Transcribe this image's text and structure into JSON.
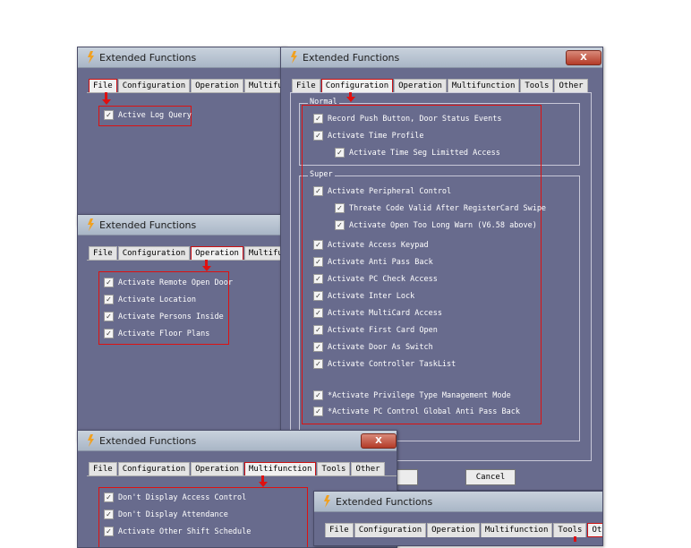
{
  "window_title": "Extended Functions",
  "close_glyph": "X",
  "tabs": {
    "file": "File",
    "configuration": "Configuration",
    "operation": "Operation",
    "multifunction": "Multifunction",
    "multifunction_cut": "Multifuncti",
    "tools": "Tools",
    "other": "Other"
  },
  "file_win": {
    "items": [
      "Active Log Query"
    ]
  },
  "operation_win": {
    "items": [
      "Activate Remote Open Door",
      "Activate Location",
      "Activate Persons Inside",
      "Activate Floor Plans"
    ]
  },
  "config_win": {
    "normal_label": "Normal",
    "normal_items": [
      "Record Push Button, Door Status Events",
      "Activate Time Profile",
      "Activate Time Seg Limitted Access"
    ],
    "super_label": "Super",
    "super_items": [
      "Activate Peripheral Control",
      "Threate Code Valid After RegisterCard Swipe",
      "Activate Open Too Long Warn (V6.58 above)",
      "Activate Access Keypad",
      "Activate Anti Pass Back",
      "Activate PC Check Access",
      "Activate Inter Lock",
      "Activate MultiCard Access",
      "Activate First Card Open",
      "Activate Door As Switch",
      "Activate Controller TaskList",
      "*Activate Privilege Type Management Mode",
      "*Activate PC Control Global Anti Pass Back"
    ],
    "cancel_label": "Cancel"
  },
  "multi_win": {
    "items": [
      "Don't Display Access Control",
      "Don't Display Attendance",
      "Activate Other Shift Schedule"
    ]
  },
  "check_glyph": "✓",
  "colors": {
    "window_bg": "#686b8d",
    "highlight_red": "#dd1111"
  }
}
